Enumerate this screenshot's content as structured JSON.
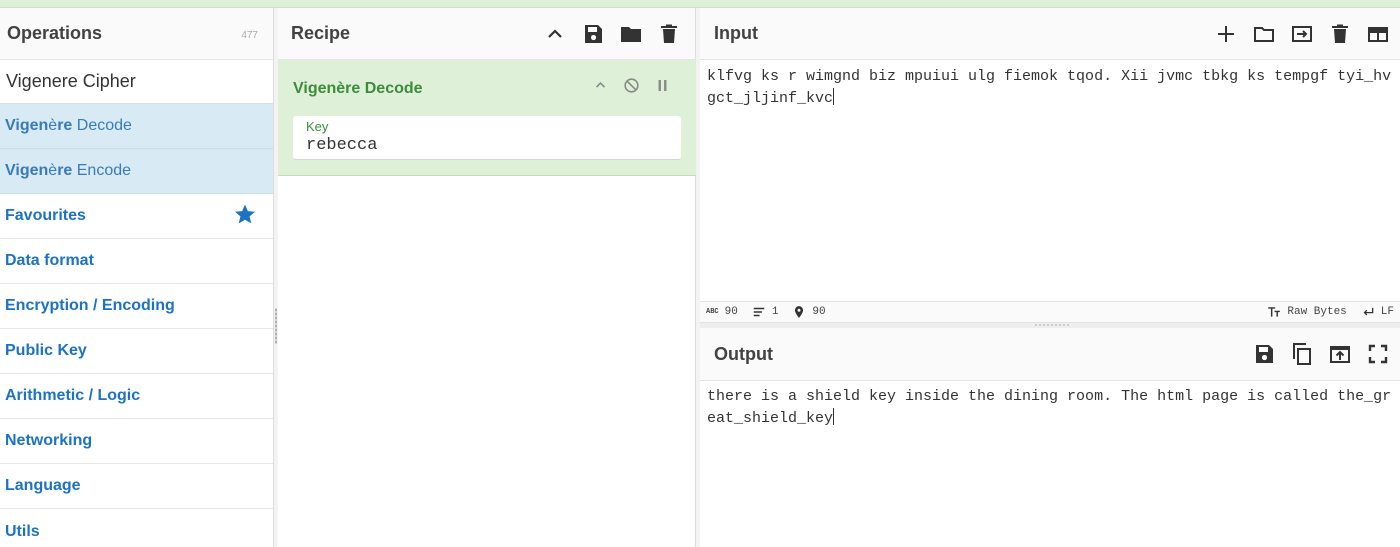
{
  "operations": {
    "title": "Operations",
    "count": "477",
    "search_value": "Vigenere Cipher",
    "results": [
      {
        "match": "Vigen",
        "accent": "è",
        "match2": "re",
        "rest": " Decode"
      },
      {
        "match": "Vigen",
        "accent": "è",
        "match2": "re",
        "rest": " Encode"
      }
    ],
    "categories": [
      "Favourites",
      "Data format",
      "Encryption / Encoding",
      "Public Key",
      "Arithmetic / Logic",
      "Networking",
      "Language",
      "Utils"
    ]
  },
  "recipe": {
    "title": "Recipe",
    "operation": {
      "name": "Vigenère Decode",
      "arg_label": "Key",
      "arg_value": "rebecca"
    }
  },
  "input": {
    "title": "Input",
    "text": "klfvg ks r wimgnd biz mpuiui ulg fiemok tqod. Xii jvmc tbkg ks tempgf tyi_hvgct_jljinf_kvc",
    "status": {
      "length": "90",
      "lines": "1",
      "position": "90",
      "encoding": "Raw Bytes",
      "eol": "LF"
    }
  },
  "output": {
    "title": "Output",
    "text": "there is a shield key inside the dining room. The html page is called the_great_shield_key"
  },
  "colors": {
    "accent_blue": "#1c73c5",
    "operation_green": "#3c8c3c",
    "recipe_bg": "#dff0d8",
    "result_bg": "#d8ebf5"
  }
}
